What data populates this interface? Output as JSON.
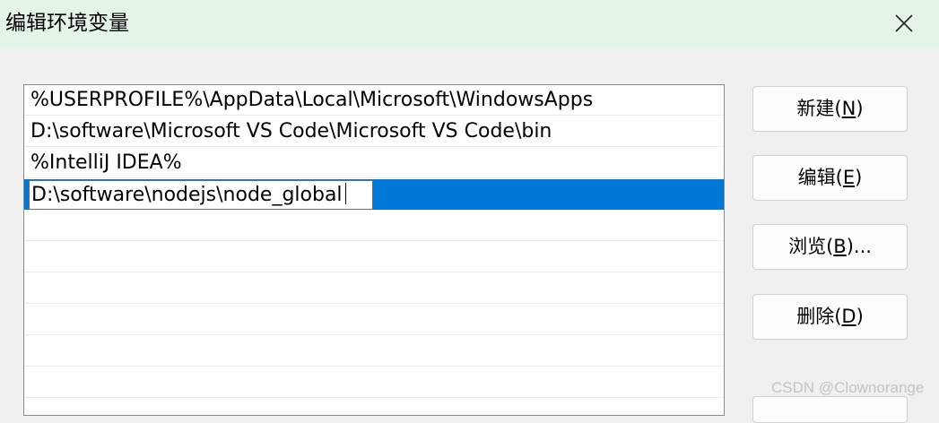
{
  "dialog": {
    "title": "编辑环境变量"
  },
  "path_list": {
    "entries": [
      "%USERPROFILE%\\AppData\\Local\\Microsoft\\WindowsApps",
      "D:\\software\\Microsoft VS Code\\Microsoft VS Code\\bin",
      "%IntelliJ IDEA%"
    ],
    "editing_value": "D:\\software\\nodejs\\node_global"
  },
  "buttons": {
    "new": {
      "label": "新建(",
      "mnemonic": "N",
      "suffix": ")"
    },
    "edit": {
      "label": "编辑(",
      "mnemonic": "E",
      "suffix": ")"
    },
    "browse": {
      "label": "浏览(",
      "mnemonic": "B",
      "suffix": ")..."
    },
    "delete": {
      "label": "删除(",
      "mnemonic": "D",
      "suffix": ")"
    }
  },
  "watermark": {
    "text": "CSDN @Clownorange"
  },
  "colors": {
    "title_bar": "#e6f4e8",
    "selection": "#0078d7"
  }
}
